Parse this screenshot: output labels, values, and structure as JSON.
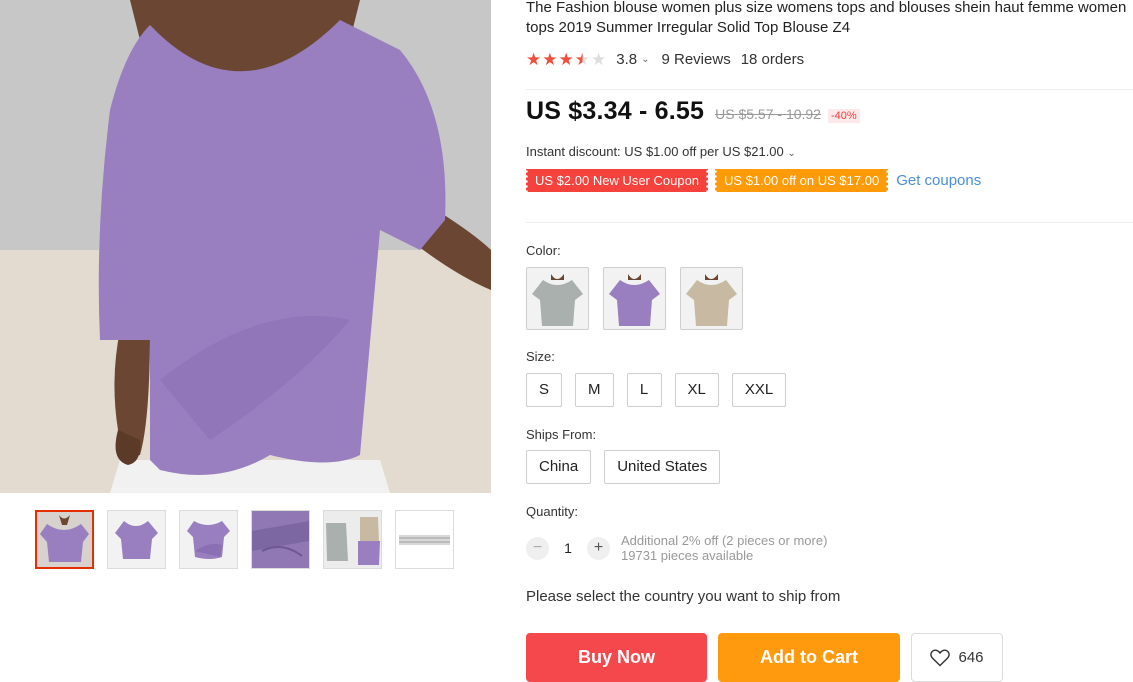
{
  "product": {
    "title": "The Fashion blouse women plus size womens tops and blouses shein haut femme women tops 2019 Summer Irregular Solid Top Blouse Z4",
    "rating": 3.8,
    "rating_text": "3.8",
    "reviews_text": "9 Reviews",
    "orders_text": "18 orders"
  },
  "pricing": {
    "price": "US $3.34 - 6.55",
    "original_price": "US $5.57 - 10.92",
    "discount": "-40%",
    "instant_discount": "Instant discount: US $1.00 off per US $21.00"
  },
  "coupons": {
    "items": [
      {
        "label": "US $2.00 New User Coupon",
        "color": "#f5423c"
      },
      {
        "label": "US $1.00 off on US $17.00",
        "color": "#ff9b08"
      }
    ],
    "get_coupons": "Get coupons"
  },
  "color": {
    "label": "Color:",
    "options": [
      {
        "name": "gray",
        "shirt": "#a9b0ad"
      },
      {
        "name": "purple",
        "shirt": "#9a7fc0"
      },
      {
        "name": "khaki",
        "shirt": "#c8b9a2"
      }
    ]
  },
  "size": {
    "label": "Size:",
    "options": [
      "S",
      "M",
      "L",
      "XL",
      "XXL"
    ]
  },
  "ships_from": {
    "label": "Ships From:",
    "options": [
      "China",
      "United States"
    ]
  },
  "quantity": {
    "label": "Quantity:",
    "value": "1",
    "minus": "−",
    "plus": "+",
    "note_line1": "Additional 2% off (2 pieces or more)",
    "note_line2": "19731 pieces available"
  },
  "ship_note": "Please select the country you want to ship from",
  "actions": {
    "buy_now": "Buy Now",
    "add_to_cart": "Add to Cart",
    "wishlist_count": "646",
    "buy_color": "#f5484c",
    "cart_color": "#ff9a0f"
  },
  "gallery": {
    "thumbnail_count": 6,
    "selected_index": 0
  }
}
